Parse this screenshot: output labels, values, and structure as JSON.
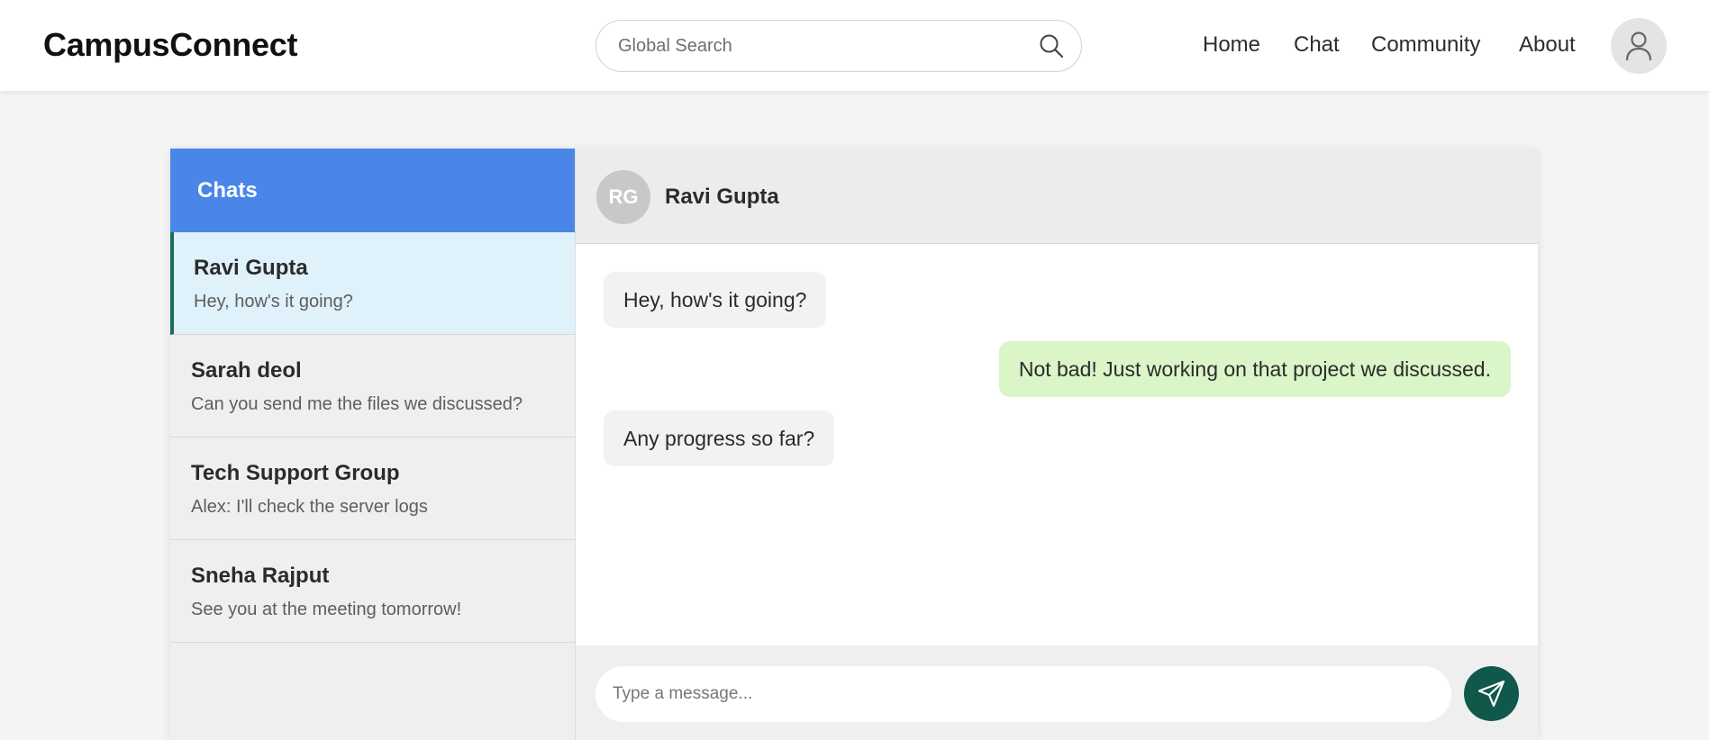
{
  "app": {
    "brand": "CampusConnect"
  },
  "header": {
    "search_placeholder": "Global Search",
    "search_icon": "search-icon",
    "nav": [
      "Home",
      "Chat",
      "Community",
      "About"
    ],
    "profile_icon": "user-icon"
  },
  "sidebar": {
    "title": "Chats",
    "chats": [
      {
        "name": "Ravi Gupta",
        "preview": "Hey, how's it going?",
        "active": true
      },
      {
        "name": "Sarah deol",
        "preview": "Can you send me the files we discussed?",
        "active": false
      },
      {
        "name": "Tech Support Group",
        "preview": "Alex: I'll check the server logs",
        "active": false
      },
      {
        "name": "Sneha Rajput",
        "preview": "See you at the meeting tomorrow!",
        "active": false
      }
    ]
  },
  "conversation": {
    "avatar_initials": "RG",
    "contact_name": "Ravi Gupta",
    "messages": [
      {
        "direction": "in",
        "text": "Hey, how's it going?"
      },
      {
        "direction": "out",
        "text": "Not bad! Just working on that project we discussed."
      },
      {
        "direction": "in",
        "text": "Any progress so far?"
      }
    ]
  },
  "composer": {
    "placeholder": "Type a message...",
    "send_icon": "send-icon"
  },
  "colors": {
    "sidebar_header": "#4a86e8",
    "active_chat_bg": "#dff1fb",
    "active_chat_border": "#1a6b5b",
    "outgoing_bubble": "#daf5c8",
    "incoming_bubble": "#f2f2f2",
    "send_button": "#10584c"
  }
}
